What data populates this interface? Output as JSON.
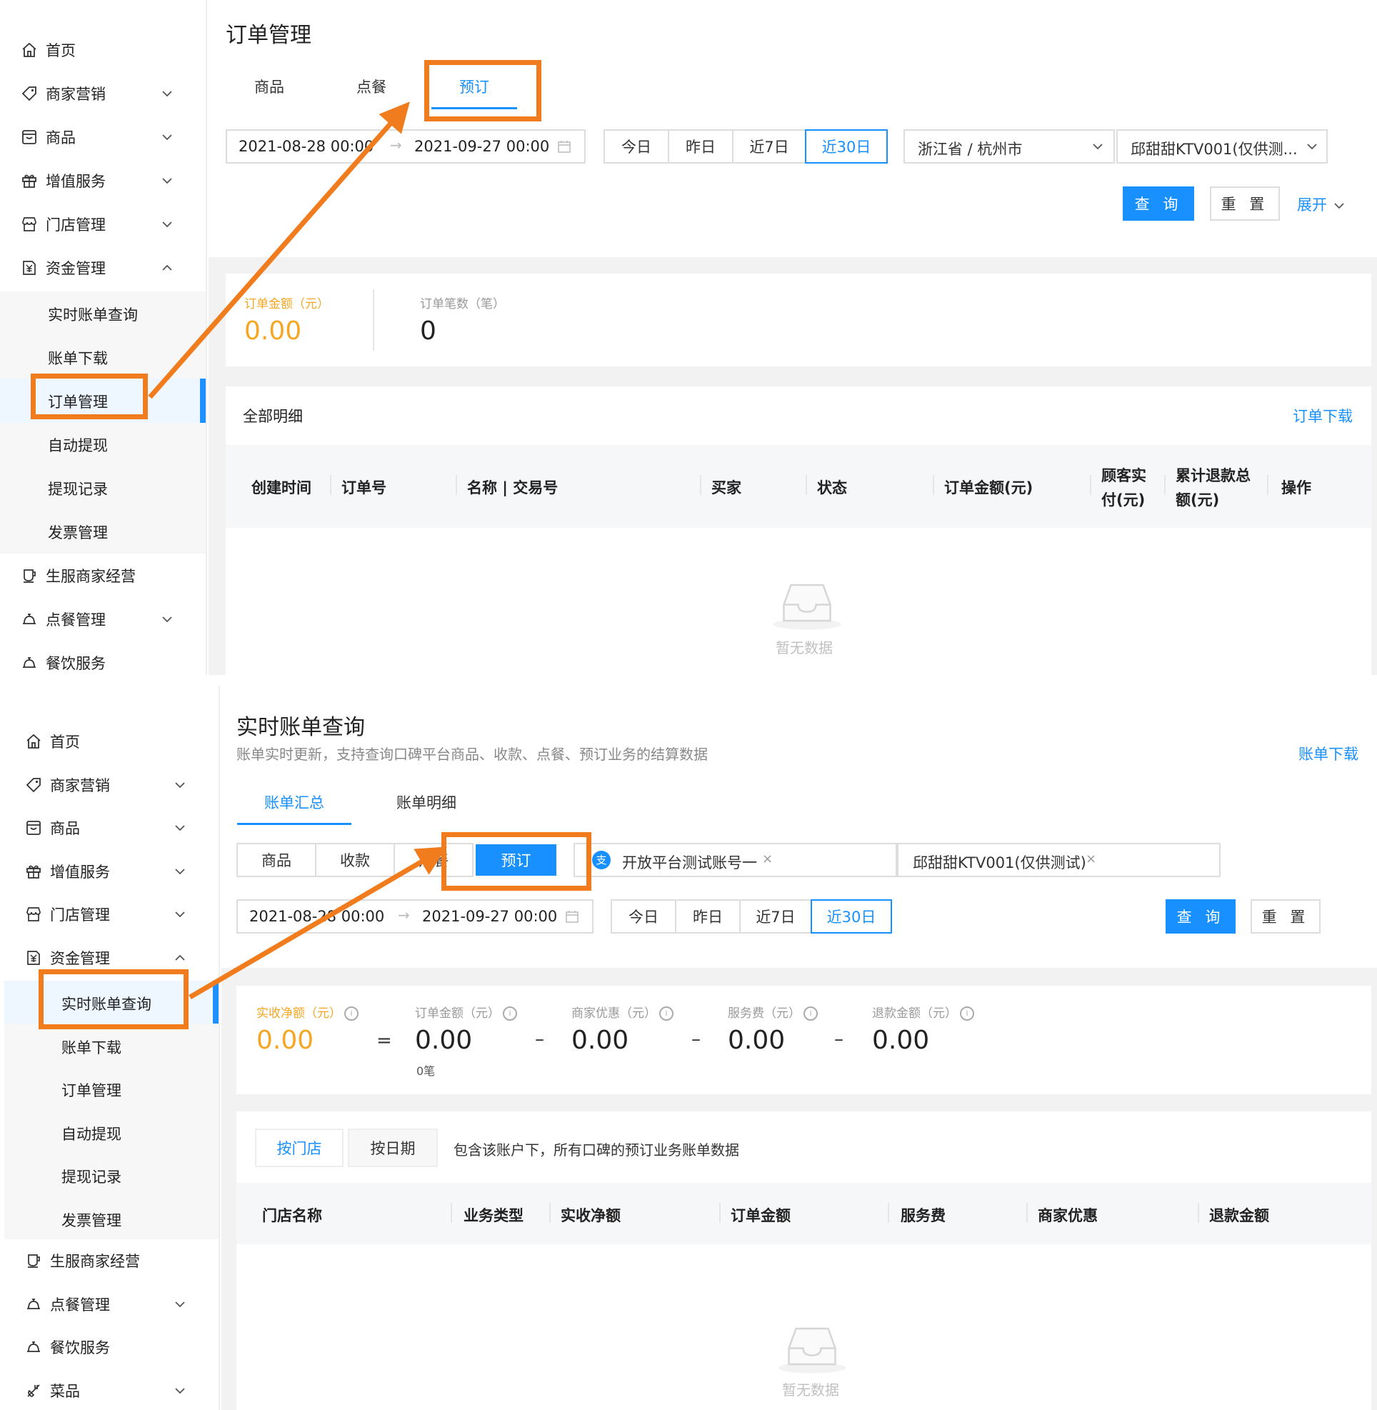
{
  "colors": {
    "accent": "#1890ff",
    "highlight": "#f07c1e",
    "amount": "#f5a623"
  },
  "top": {
    "sidebar": {
      "items": [
        {
          "label": "首页",
          "icon": "home-icon"
        },
        {
          "label": "商家营销",
          "icon": "tag-icon"
        },
        {
          "label": "商品",
          "icon": "box-icon"
        },
        {
          "label": "增值服务",
          "icon": "gift-icon"
        },
        {
          "label": "门店管理",
          "icon": "store-icon"
        },
        {
          "label": "资金管理",
          "icon": "money-icon"
        }
      ],
      "sub_items": [
        "实时账单查询",
        "账单下载",
        "订单管理",
        "自动提现",
        "提现记录",
        "发票管理"
      ],
      "after_items": [
        {
          "label": "生服商家经营",
          "icon": "cup-icon"
        },
        {
          "label": "点餐管理",
          "icon": "cloche-icon"
        },
        {
          "label": "餐饮服务",
          "icon": "cloche-icon"
        }
      ]
    },
    "page_title": "订单管理",
    "tabs": [
      "商品",
      "点餐",
      "预订"
    ],
    "date_start": "2021-08-28 00:00",
    "date_end": "2021-09-27 00:00",
    "quick_dates": [
      "今日",
      "昨日",
      "近7日",
      "近30日"
    ],
    "region": "浙江省 / 杭州市",
    "store": "邱甜甜KTV001(仅供测...",
    "query_label": "查 询",
    "reset_label": "重 置",
    "expand_label": "展开",
    "stats": [
      {
        "label": "订单金额（元）",
        "value": "0.00"
      },
      {
        "label": "订单笔数（笔）",
        "value": "0"
      }
    ],
    "detail_title": "全部明细",
    "download_label": "订单下载",
    "columns": [
      "创建时间",
      "订单号",
      "名称 | 交易号",
      "买家",
      "状态",
      "订单金额(元)",
      "顾客实付(元)",
      "累计退款总额(元)",
      "操作"
    ],
    "empty_text": "暂无数据"
  },
  "bottom": {
    "sidebar": {
      "items": [
        {
          "label": "首页",
          "icon": "home-icon"
        },
        {
          "label": "商家营销",
          "icon": "tag-icon"
        },
        {
          "label": "商品",
          "icon": "box-icon"
        },
        {
          "label": "增值服务",
          "icon": "gift-icon"
        },
        {
          "label": "门店管理",
          "icon": "store-icon"
        },
        {
          "label": "资金管理",
          "icon": "money-icon"
        }
      ],
      "sub_items": [
        "实时账单查询",
        "账单下载",
        "订单管理",
        "自动提现",
        "提现记录",
        "发票管理"
      ],
      "after_items": [
        {
          "label": "生服商家经营",
          "icon": "cup-icon"
        },
        {
          "label": "点餐管理",
          "icon": "cloche-icon"
        },
        {
          "label": "餐饮服务",
          "icon": "cloche-icon"
        },
        {
          "label": "菜品",
          "icon": "dish-icon"
        }
      ]
    },
    "page_title": "实时账单查询",
    "subtitle": "账单实时更新，支持查询口碑平台商品、收款、点餐、预订业务的结算数据",
    "download_label": "账单下载",
    "tabs": [
      "账单汇总",
      "账单明细"
    ],
    "business_types": [
      "商品",
      "收款",
      "点餐",
      "预订"
    ],
    "account_tag": "开放平台测试账号一",
    "store_tag": "邱甜甜KTV001(仅供测试)",
    "date_start": "2021-08-28 00:00",
    "date_end": "2021-09-27 00:00",
    "quick_dates": [
      "今日",
      "昨日",
      "近7日",
      "近30日"
    ],
    "query_label": "查 询",
    "reset_label": "重 置",
    "stats": [
      {
        "label": "实收净额（元）",
        "value": "0.00"
      },
      {
        "label": "订单金额（元）",
        "value": "0.00",
        "sub": "0笔"
      },
      {
        "label": "商家优惠（元）",
        "value": "0.00"
      },
      {
        "label": "服务费（元）",
        "value": "0.00"
      },
      {
        "label": "退款金额（元）",
        "value": "0.00"
      }
    ],
    "operators": [
      "=",
      "–",
      "–",
      "–"
    ],
    "group_tabs": [
      "按门店",
      "按日期"
    ],
    "group_note": "包含该账户下，所有口碑的预订业务账单数据",
    "columns": [
      "门店名称",
      "业务类型",
      "实收净额",
      "订单金额",
      "服务费",
      "商家优惠",
      "退款金额"
    ],
    "empty_text": "暂无数据"
  }
}
